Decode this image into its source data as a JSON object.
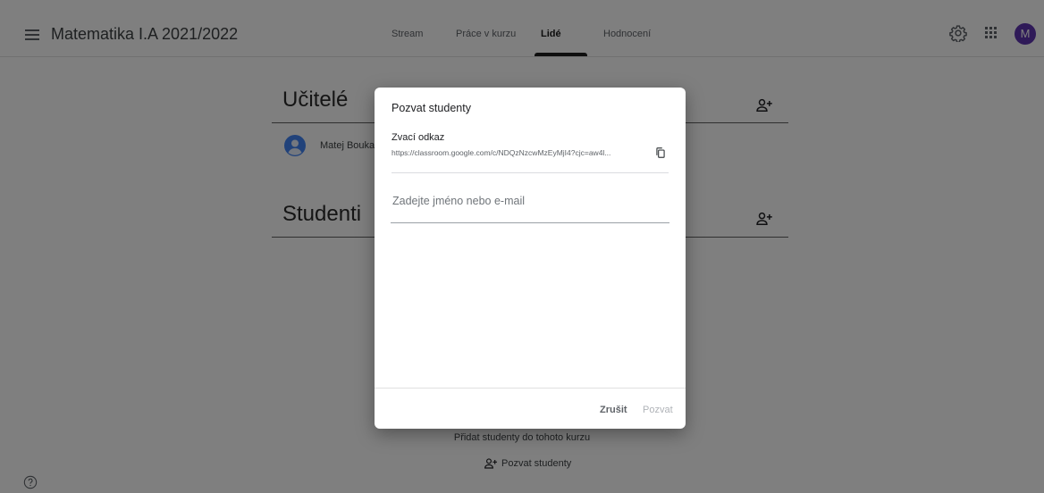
{
  "header": {
    "course_title": "Matematika I.A 2021/2022",
    "tabs": [
      {
        "label": "Stream"
      },
      {
        "label": "Práce v kurzu"
      },
      {
        "label": "Lidé",
        "active": true
      },
      {
        "label": "Hodnocení"
      }
    ],
    "avatar_initial": "M",
    "avatar_color": "#5e35b1"
  },
  "people": {
    "teachers_title": "Učitelé",
    "teachers": [
      {
        "name": "Matej Bouka"
      }
    ],
    "students_title": "Studenti",
    "empty_text": "Přidat studenty do tohoto kurzu",
    "invite_link_label": "Pozvat studenty"
  },
  "dialog": {
    "title": "Pozvat studenty",
    "link_label": "Zvací odkaz",
    "link_url": "https://classroom.google.com/c/NDQzNzcwMzEyMjI4?cjc=aw4l...",
    "email_placeholder": "Zadejte jméno nebo e-mail",
    "email_value": "",
    "cancel_label": "Zrušit",
    "invite_label": "Pozvat"
  },
  "icons": {
    "menu": "menu-icon",
    "settings": "gear-icon",
    "apps": "apps-icon",
    "add_person": "add-person-icon",
    "copy": "copy-icon",
    "help": "help-icon"
  }
}
